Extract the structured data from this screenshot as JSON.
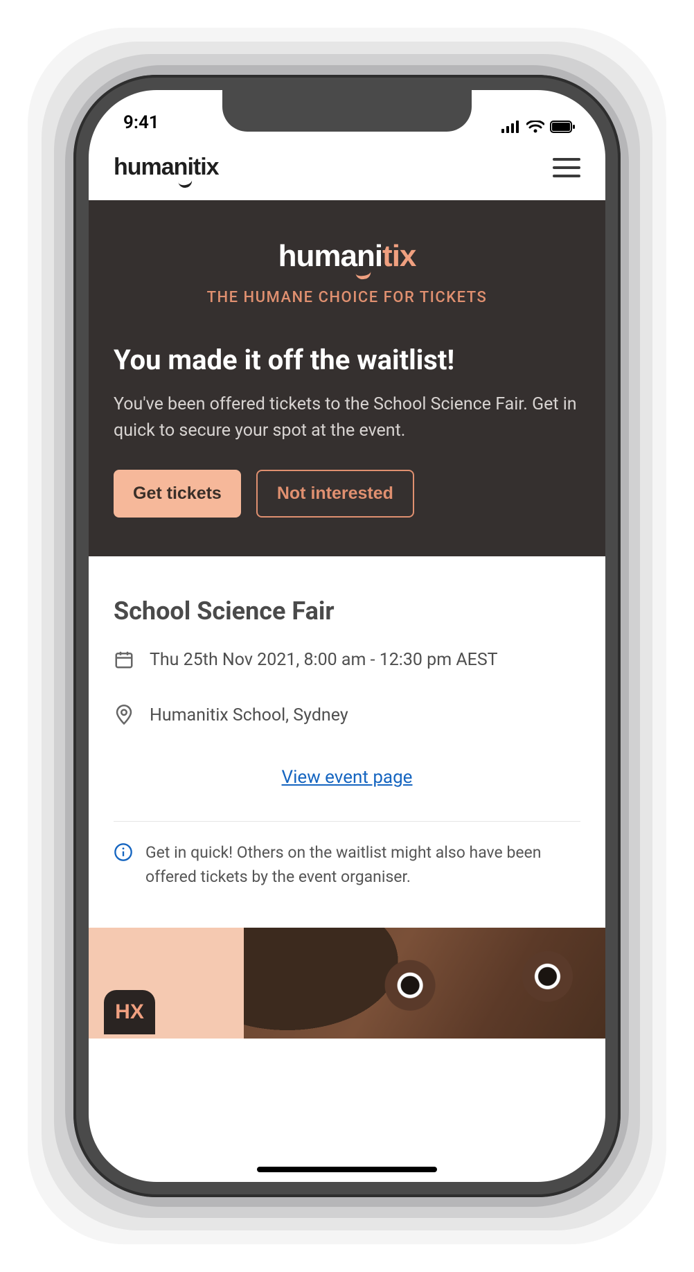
{
  "status_bar": {
    "time": "9:41"
  },
  "header": {
    "brand": "humanitix"
  },
  "hero": {
    "brand_white": "Humani",
    "brand_orange": "TIX",
    "tagline": "THE HUMANE CHOICE FOR TICKETS",
    "title": "You made it off the waitlist!",
    "body": "You've been offered tickets to the School Science Fair. Get in quick to secure your spot at the event.",
    "primary_cta": "Get tickets",
    "secondary_cta": "Not interested"
  },
  "event": {
    "title": "School Science Fair",
    "datetime": "Thu 25th Nov 2021, 8:00 am - 12:30 pm AEST",
    "location": "Humanitix School, Sydney",
    "view_link": "View event page",
    "notice": "Get in quick! Others on the waitlist might also have been offered tickets by the event organiser."
  },
  "footer": {
    "badge": "HX"
  }
}
